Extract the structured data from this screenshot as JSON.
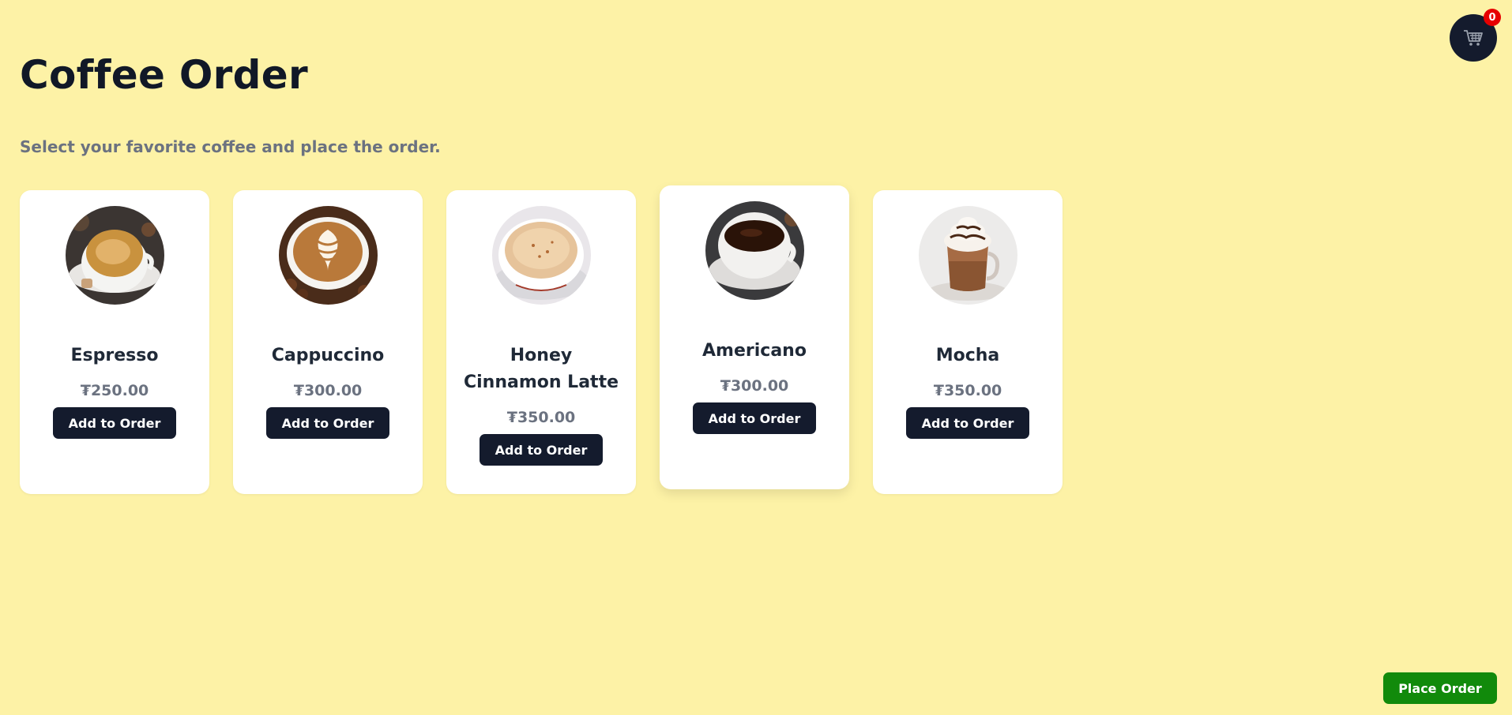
{
  "header": {
    "title": "Coffee Order",
    "subtitle": "Select your favorite coffee and place the order."
  },
  "cart": {
    "icon": "cart-icon",
    "count": "0"
  },
  "products": [
    {
      "name": "Espresso",
      "price": "₮250.00",
      "button_label": "Add to Order",
      "image": "espresso-photo"
    },
    {
      "name": "Cappuccino",
      "price": "₮300.00",
      "button_label": "Add to Order",
      "image": "cappuccino-photo"
    },
    {
      "name": "Honey Cinnamon Latte",
      "price": "₮350.00",
      "button_label": "Add to Order",
      "image": "honey-cinnamon-latte-photo"
    },
    {
      "name": "Americano",
      "price": "₮300.00",
      "button_label": "Add to Order",
      "image": "americano-photo"
    },
    {
      "name": "Mocha",
      "price": "₮350.00",
      "button_label": "Add to Order",
      "image": "mocha-photo"
    }
  ],
  "footer": {
    "place_order_label": "Place Order"
  },
  "colors": {
    "background": "#fdf2a6",
    "dark": "#141b2d",
    "place_order": "#118a0b",
    "badge": "#e60000"
  }
}
